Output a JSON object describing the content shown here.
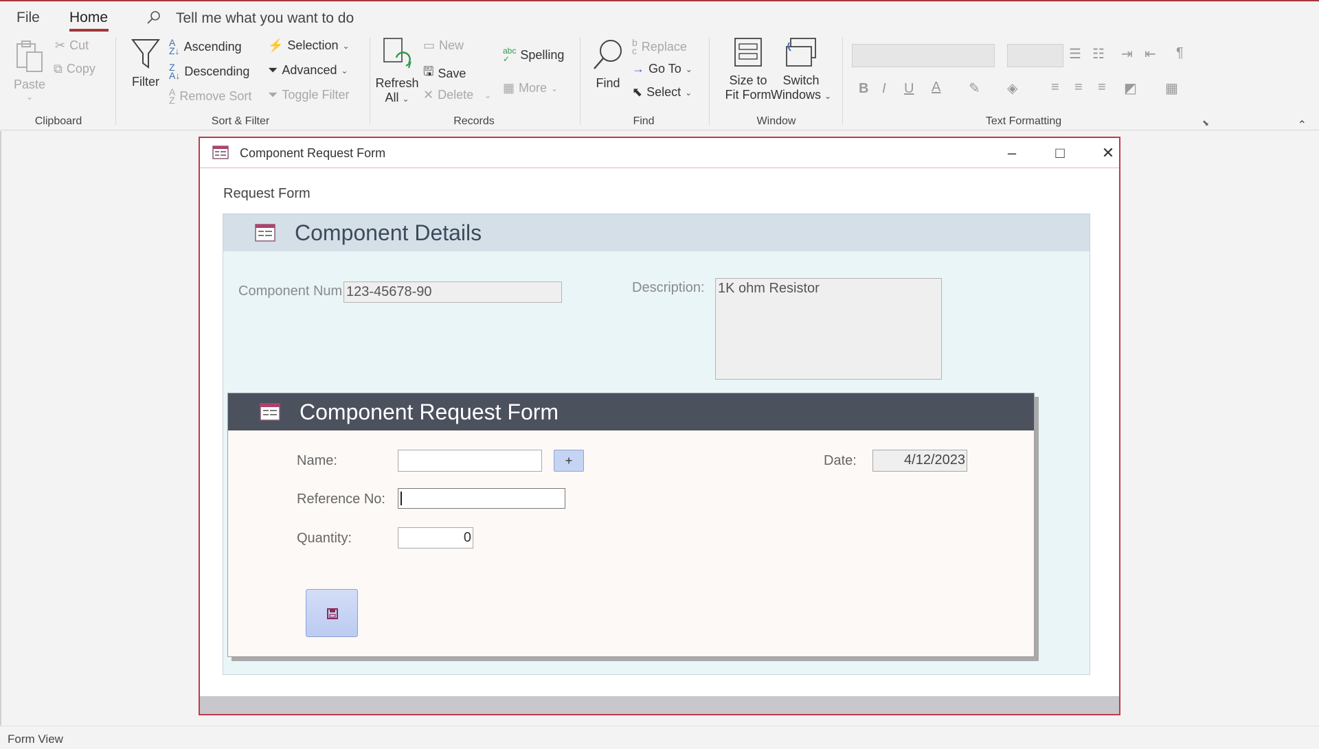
{
  "menu": {
    "file": "File",
    "home": "Home",
    "tell_me": "Tell me what you want to do"
  },
  "ribbon": {
    "clipboard": {
      "label": "Clipboard",
      "paste": "Paste",
      "cut": "Cut",
      "copy": "Copy"
    },
    "sort_filter": {
      "label": "Sort & Filter",
      "filter": "Filter",
      "ascending": "Ascending",
      "descending": "Descending",
      "remove_sort": "Remove Sort",
      "selection": "Selection",
      "advanced": "Advanced",
      "toggle_filter": "Toggle Filter"
    },
    "records": {
      "label": "Records",
      "refresh": "Refresh",
      "refresh_all": "All",
      "new": "New",
      "save": "Save",
      "delete": "Delete",
      "spelling": "Spelling",
      "more": "More"
    },
    "find": {
      "label": "Find",
      "find": "Find",
      "replace": "Replace",
      "go_to": "Go To",
      "select": "Select"
    },
    "window": {
      "label": "Window",
      "size_to_fit_1": "Size to",
      "size_to_fit_2": "Fit Form",
      "switch_1": "Switch",
      "switch_2": "Windows"
    },
    "text_formatting": {
      "label": "Text Formatting",
      "bold": "B",
      "italic": "I",
      "underline": "U",
      "font_color": "A"
    }
  },
  "form_window": {
    "title": "Component Request Form",
    "request_label": "Request Form",
    "details": {
      "title": "Component Details",
      "component_num_label": "Component Num",
      "component_num_value": "123-45678-90",
      "description_label": "Description:",
      "description_value": "1K ohm Resistor"
    },
    "subform": {
      "title": "Component Request Form",
      "name_label": "Name:",
      "name_value": "",
      "plus_label": "+",
      "reference_label": "Reference No:",
      "reference_value": "",
      "quantity_label": "Quantity:",
      "quantity_value": "0",
      "date_label": "Date:",
      "date_value": "4/12/2023"
    }
  },
  "status": {
    "view": "Form View"
  },
  "colors": {
    "accent": "#a4373a",
    "form_border": "#c0394a",
    "details_header": "#d5dfe8",
    "subform_header": "#4b515d"
  }
}
